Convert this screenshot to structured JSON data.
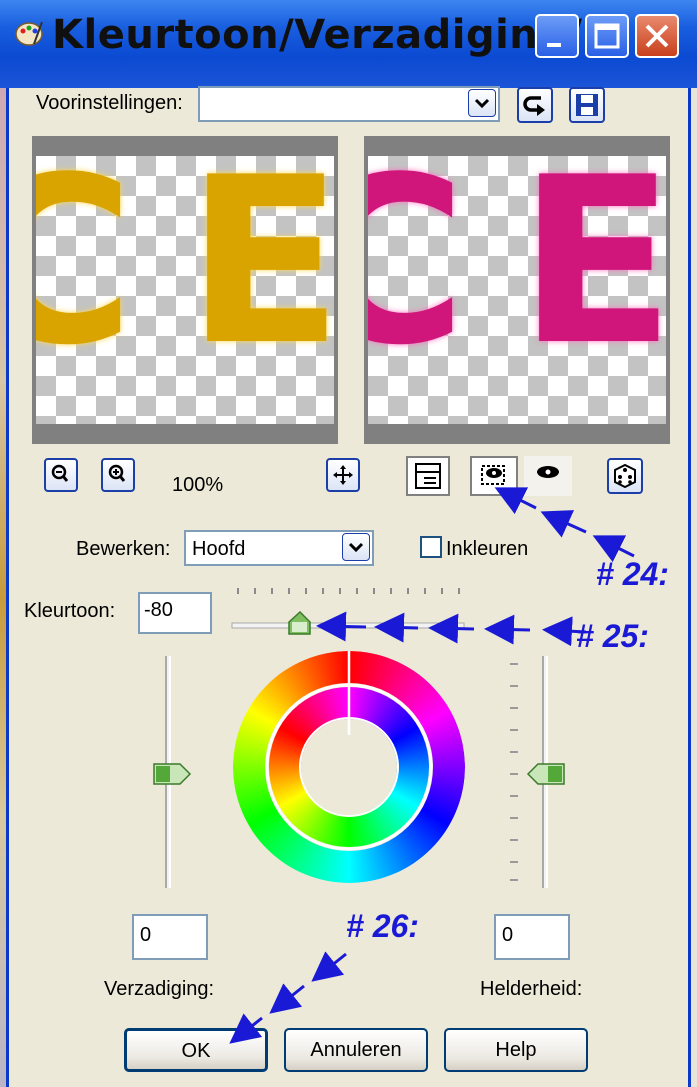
{
  "window": {
    "title": "Kleurtoon/Verzadiging/...",
    "controls": [
      "minimize",
      "maximize",
      "close"
    ]
  },
  "presets": {
    "label": "Voorinstellingen:",
    "value": ""
  },
  "zoom": {
    "level": "100%"
  },
  "edit": {
    "label": "Bewerken:",
    "value": "Hoofd",
    "colorize_label": "Inkleuren",
    "colorize_checked": false
  },
  "hue": {
    "label": "Kleurtoon:",
    "value": "-80"
  },
  "saturation": {
    "label": "Verzadiging:",
    "value": "0"
  },
  "lightness": {
    "label": "Helderheid:",
    "value": "0"
  },
  "buttons": {
    "ok": "OK",
    "cancel": "Annuleren",
    "help": "Help"
  },
  "annotations": {
    "a24": "# 24:",
    "a25": "# 25:",
    "a26": "# 26:"
  },
  "colors": {
    "title_bar": "#0b4ad2",
    "annotation": "#1a1ad6",
    "before_preview": "#d9a400",
    "after_preview": "#d0157b"
  }
}
